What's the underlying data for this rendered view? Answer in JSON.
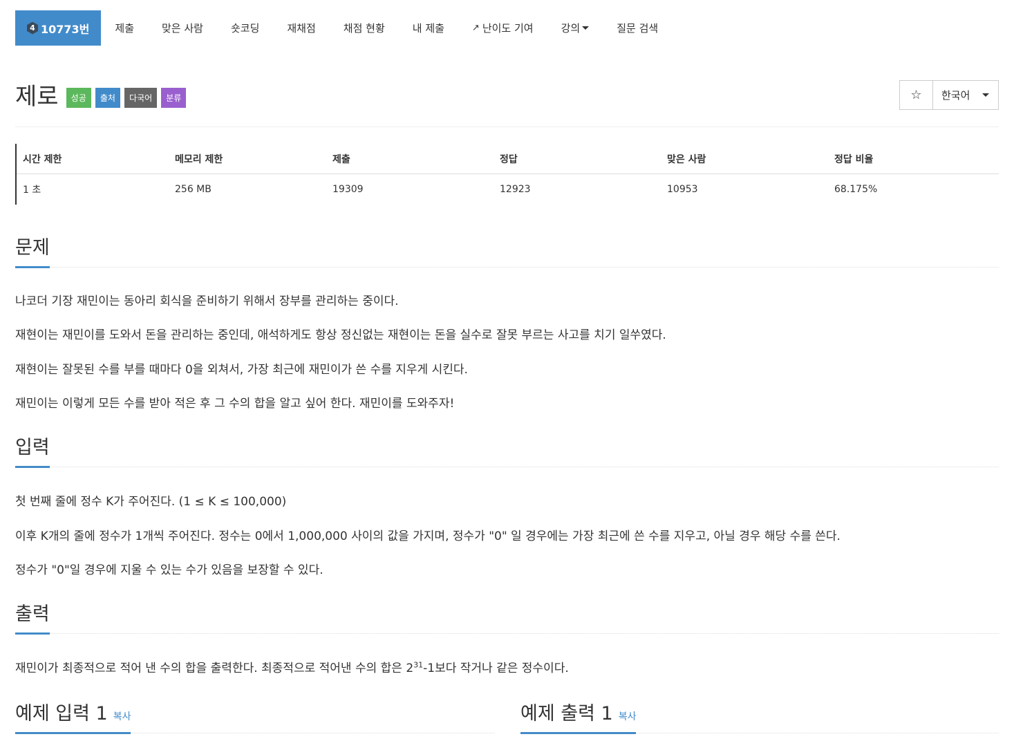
{
  "nav": {
    "problem_tier": "4",
    "problem_id": "10773번",
    "items": [
      "제출",
      "맞은 사람",
      "숏코딩",
      "재채점",
      "채점 현황",
      "내 제출",
      "난이도 기여",
      "강의",
      "질문 검색"
    ]
  },
  "problem": {
    "title": "제로",
    "labels": [
      "성공",
      "출처",
      "다국어",
      "분류"
    ],
    "language": "한국어"
  },
  "info": {
    "headers": [
      "시간 제한",
      "메모리 제한",
      "제출",
      "정답",
      "맞은 사람",
      "정답 비율"
    ],
    "values": [
      "1 초",
      "256 MB",
      "19309",
      "12923",
      "10953",
      "68.175%"
    ]
  },
  "sections": {
    "description_title": "문제",
    "description": [
      "나코더 기장 재민이는 동아리 회식을 준비하기 위해서 장부를 관리하는 중이다.",
      "재현이는 재민이를 도와서 돈을 관리하는 중인데, 애석하게도 항상 정신없는 재현이는 돈을 실수로 잘못 부르는 사고를 치기 일쑤였다.",
      "재현이는 잘못된 수를 부를 때마다 0을 외쳐서, 가장 최근에 재민이가 쓴 수를 지우게 시킨다.",
      "재민이는 이렇게 모든 수를 받아 적은 후 그 수의 합을 알고 싶어 한다. 재민이를 도와주자!"
    ],
    "input_title": "입력",
    "input": [
      "첫 번째 줄에 정수 K가 주어진다. (1 ≤ K ≤ 100,000)",
      "이후 K개의 줄에 정수가 1개씩 주어진다. 정수는 0에서 1,000,000 사이의 값을 가지며, 정수가 \"0\" 일 경우에는 가장 최근에 쓴 수를 지우고, 아닐 경우 해당 수를 쓴다.",
      "정수가 \"0\"일 경우에 지울 수 있는 수가 있음을 보장할 수 있다."
    ],
    "output_title": "출력",
    "output_before": "재민이가 최종적으로 적어 낸 수의 합을 출력한다. 최종적으로 적어낸 수의 합은 2",
    "output_sup": "31",
    "output_after": "-1보다 작거나 같은 정수이다.",
    "sample_input_title": "예제 입력 1",
    "sample_output_title": "예제 출력 1",
    "copy_label": "복사"
  }
}
